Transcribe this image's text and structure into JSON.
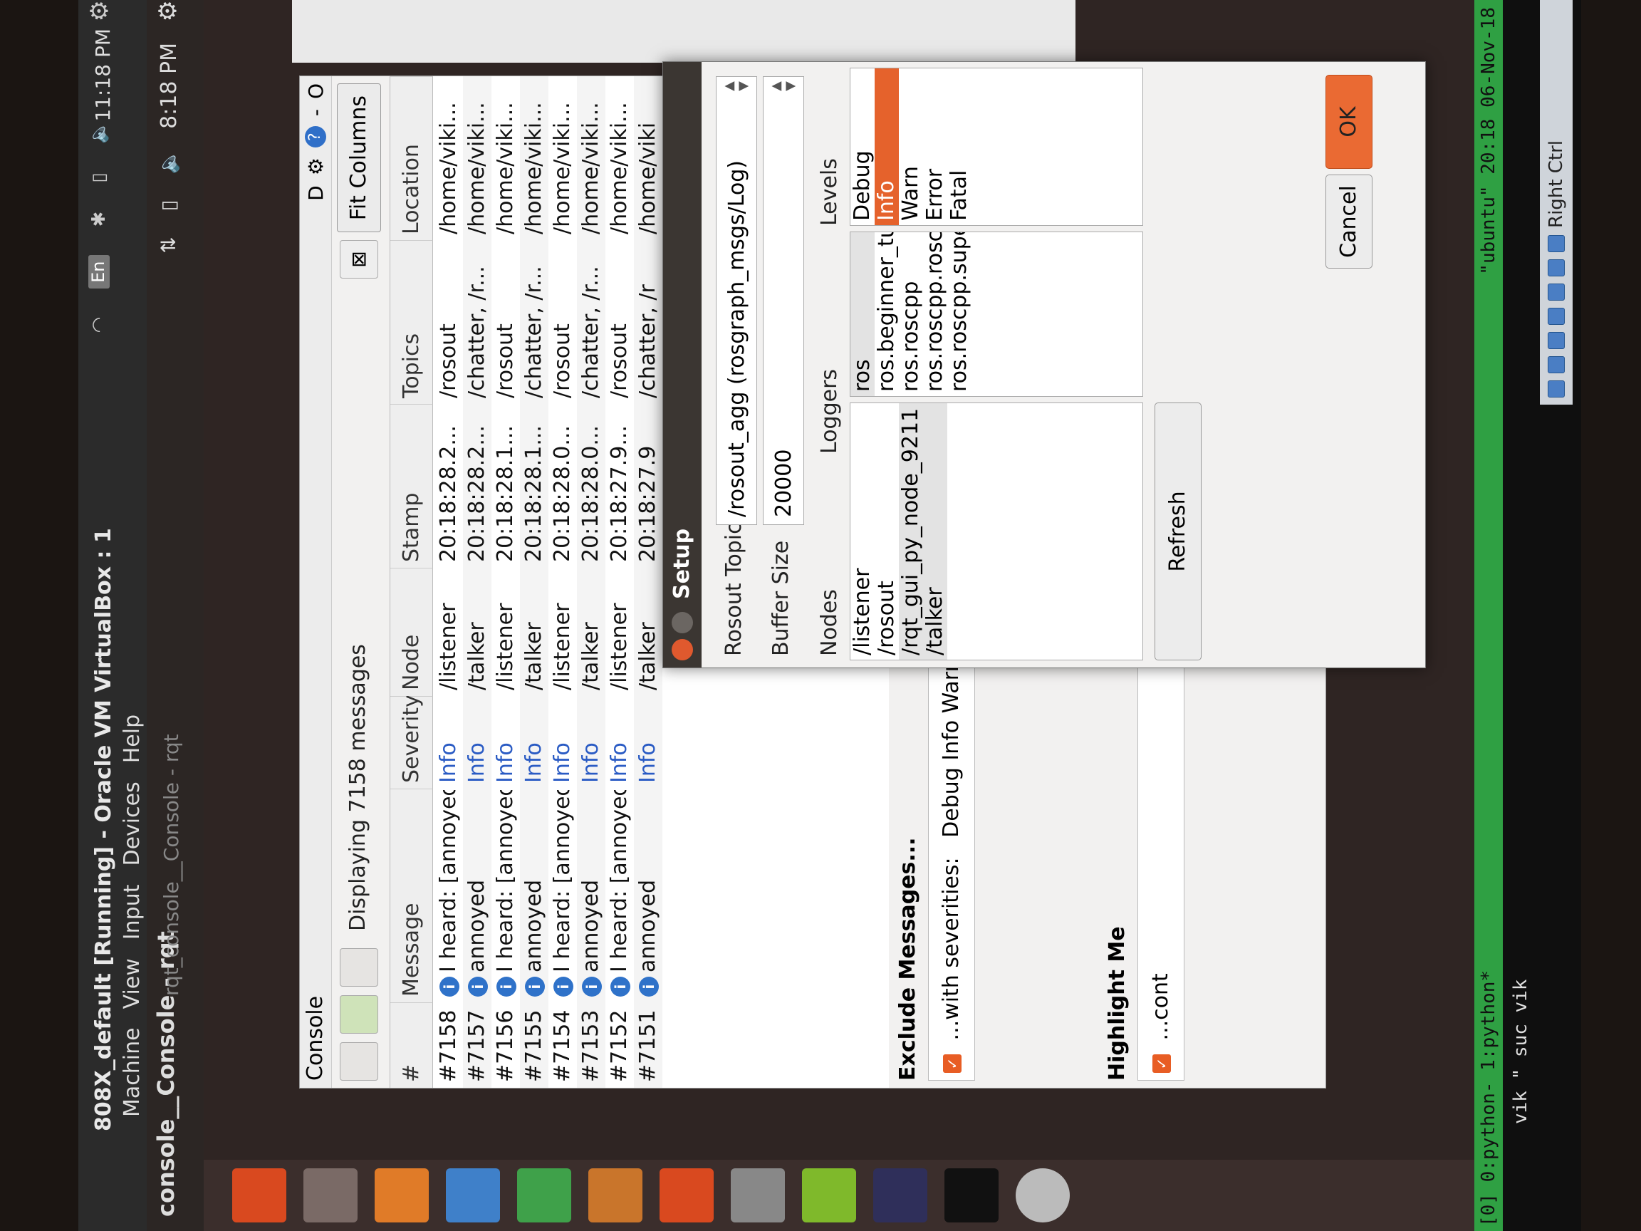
{
  "host": {
    "title": "808X_default [Running] - Oracle VM VirtualBox : 1",
    "menu": [
      "Machine",
      "View",
      "Input",
      "Devices",
      "Help"
    ],
    "clock": "11:18 PM",
    "lang": "En"
  },
  "guest_panel": {
    "title": "console__Console - rqt",
    "subtitle": "rqt_console__Console - rqt",
    "clock": "8:18 PM"
  },
  "console": {
    "title": "Console",
    "displaying": "Displaying 7158 messages",
    "fit_columns": "Fit Columns",
    "columns": [
      "#",
      "Message",
      "Severity",
      "Node",
      "Stamp",
      "Topics",
      "Location"
    ],
    "rows": [
      {
        "num": "#7158",
        "message": "I heard: [annoyed]",
        "severity": "Info",
        "node": "/listener",
        "stamp": "20:18:28.2...",
        "topics": "/rosout",
        "location": "/home/viki..."
      },
      {
        "num": "#7157",
        "message": "annoyed",
        "severity": "Info",
        "node": "/talker",
        "stamp": "20:18:28.2...",
        "topics": "/chatter, /r...",
        "location": "/home/viki..."
      },
      {
        "num": "#7156",
        "message": "I heard: [annoyed]",
        "severity": "Info",
        "node": "/listener",
        "stamp": "20:18:28.1...",
        "topics": "/rosout",
        "location": "/home/viki..."
      },
      {
        "num": "#7155",
        "message": "annoyed",
        "severity": "Info",
        "node": "/talker",
        "stamp": "20:18:28.1...",
        "topics": "/chatter, /r...",
        "location": "/home/viki..."
      },
      {
        "num": "#7154",
        "message": "I heard: [annoyed]",
        "severity": "Info",
        "node": "/listener",
        "stamp": "20:18:28.0...",
        "topics": "/rosout",
        "location": "/home/viki..."
      },
      {
        "num": "#7153",
        "message": "annoyed",
        "severity": "Info",
        "node": "/talker",
        "stamp": "20:18:28.0...",
        "topics": "/chatter, /r...",
        "location": "/home/viki..."
      },
      {
        "num": "#7152",
        "message": "I heard: [annoyed]",
        "severity": "Info",
        "node": "/listener",
        "stamp": "20:18:27.9...",
        "topics": "/rosout",
        "location": "/home/viki..."
      },
      {
        "num": "#7151",
        "message": "annoyed",
        "severity": "Info",
        "node": "/talker",
        "stamp": "20:18:27.9",
        "topics": "/chatter, /r",
        "location": "/home/viki"
      }
    ],
    "exclude_title": "Exclude Messages...",
    "exclude_label": "...with severities:",
    "exclude_levels": "Debug  Info  Warn  Error  Fatal",
    "highlight_title": "Highlight Me",
    "highlight_label": "...cont"
  },
  "setup": {
    "title": "Setup",
    "rosout_label": "Rosout Topic",
    "rosout_value": "/rosout_agg (rosgraph_msgs/Log)",
    "buffer_label": "Buffer Size",
    "buffer_value": "20000",
    "nodes_label": "Nodes",
    "loggers_label": "Loggers",
    "levels_label": "Levels",
    "nodes": [
      "/listener",
      "/rosout",
      "/rqt_gui_py_node_9211",
      "/talker"
    ],
    "loggers": [
      "ros",
      "ros.beginner_tutorials",
      "ros.roscpp",
      "ros.roscpp.roscpp_internal",
      "ros.roscpp.superdebug"
    ],
    "levels": [
      "Debug",
      "Info",
      "Warn",
      "Error",
      "Fatal"
    ],
    "selected_level": "Info",
    "refresh": "Refresh",
    "cancel": "Cancel",
    "ok": "OK"
  },
  "terminal": {
    "tmux_left": "[0] 0:python- 1:python*",
    "tmux_right": "\"ubuntu\" 20:18 06-Nov-18",
    "lines": [
      "vik",
      "\"",
      "suc",
      "vik"
    ],
    "right_ctrl": "Right Ctrl"
  },
  "colors": {
    "accent": "#e5622c",
    "info_blue": "#2f72c9",
    "tmux_green": "#2fa043"
  }
}
